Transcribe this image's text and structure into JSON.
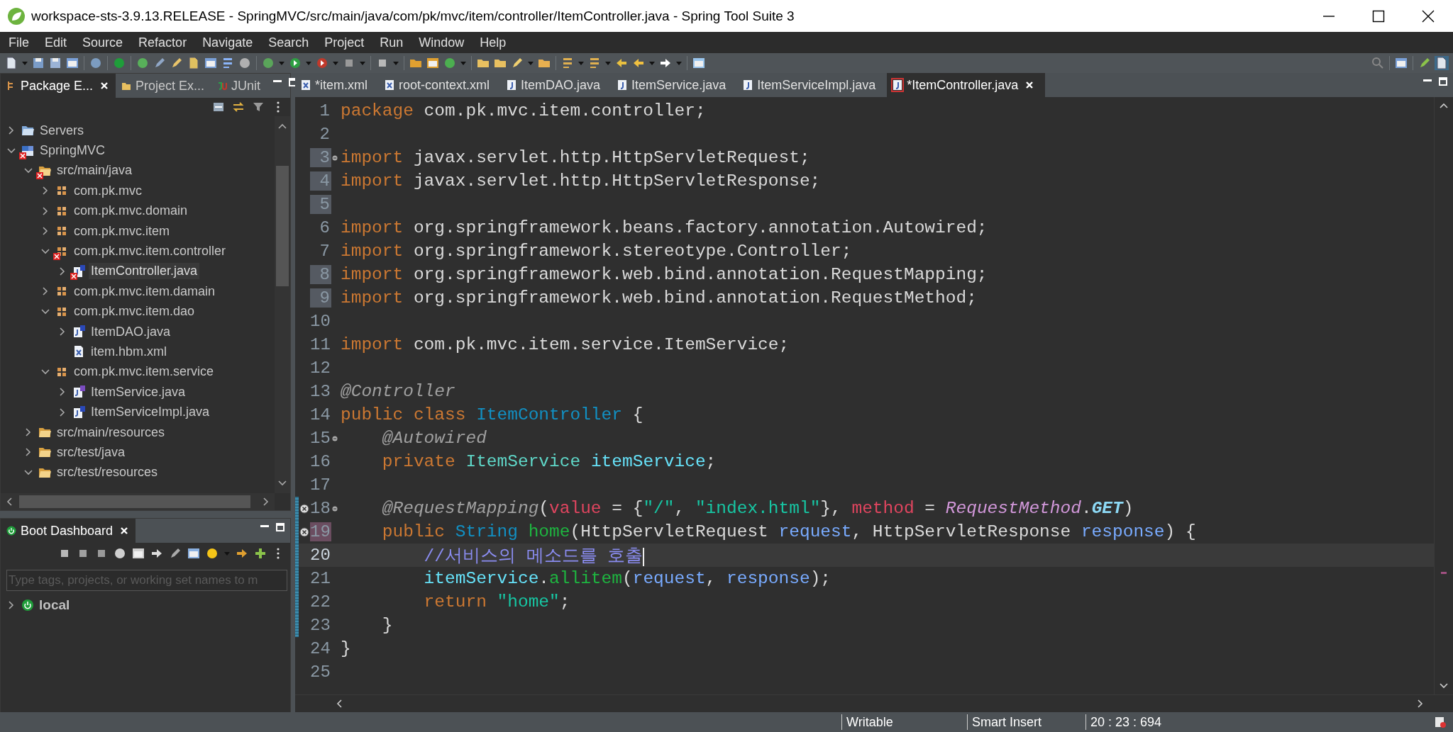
{
  "window": {
    "title": "workspace-sts-3.9.13.RELEASE - SpringMVC/src/main/java/com/pk/mvc/item/controller/ItemController.java - Spring Tool Suite 3"
  },
  "menu": [
    "File",
    "Edit",
    "Source",
    "Refactor",
    "Navigate",
    "Search",
    "Project",
    "Run",
    "Window",
    "Help"
  ],
  "explorer": {
    "tabs": [
      {
        "label": "Package E...",
        "selected": true,
        "kind": "package-explorer"
      },
      {
        "label": "Project Ex...",
        "selected": false,
        "kind": "project-explorer"
      },
      {
        "label": "JUnit",
        "selected": false,
        "kind": "junit"
      }
    ],
    "tree": [
      {
        "label": "Servers",
        "kind": "folder",
        "expanded": false,
        "selected": false,
        "error": false
      },
      {
        "label": "SpringMVC",
        "kind": "project",
        "expanded": true,
        "selected": false,
        "error": true,
        "children": [
          {
            "label": "src/main/java",
            "kind": "source-folder",
            "expanded": true,
            "selected": false,
            "error": true,
            "children": [
              {
                "label": "com.pk.mvc",
                "kind": "package",
                "expanded": false,
                "selected": false,
                "error": false
              },
              {
                "label": "com.pk.mvc.domain",
                "kind": "package",
                "expanded": false,
                "selected": false,
                "error": false
              },
              {
                "label": "com.pk.mvc.item",
                "kind": "package",
                "expanded": false,
                "selected": false,
                "error": false
              },
              {
                "label": "com.pk.mvc.item.controller",
                "kind": "package",
                "expanded": true,
                "selected": false,
                "error": true,
                "children": [
                  {
                    "label": "ItemController.java",
                    "kind": "java-class",
                    "expanded": false,
                    "selected": true,
                    "error": true
                  }
                ]
              },
              {
                "label": "com.pk.mvc.item.damain",
                "kind": "package",
                "expanded": false,
                "selected": false,
                "error": false
              },
              {
                "label": "com.pk.mvc.item.dao",
                "kind": "package",
                "expanded": true,
                "selected": false,
                "error": false,
                "children": [
                  {
                    "label": "ItemDAO.java",
                    "kind": "java-class",
                    "expanded": false,
                    "selected": false,
                    "error": false
                  },
                  {
                    "label": "item.hbm.xml",
                    "kind": "xml",
                    "selected": false,
                    "error": false
                  }
                ]
              },
              {
                "label": "com.pk.mvc.item.service",
                "kind": "package",
                "expanded": true,
                "selected": false,
                "error": false,
                "children": [
                  {
                    "label": "ItemService.java",
                    "kind": "java-interface",
                    "expanded": false,
                    "selected": false,
                    "error": false
                  },
                  {
                    "label": "ItemServiceImpl.java",
                    "kind": "java-class",
                    "expanded": false,
                    "selected": false,
                    "error": false
                  }
                ]
              }
            ]
          },
          {
            "label": "src/main/resources",
            "kind": "source-folder",
            "expanded": false,
            "selected": false,
            "error": false
          },
          {
            "label": "src/test/java",
            "kind": "source-folder",
            "expanded": false,
            "selected": false,
            "error": false
          },
          {
            "label": "src/test/resources",
            "kind": "source-folder",
            "expanded": true,
            "selected": false,
            "error": false
          }
        ]
      }
    ]
  },
  "boot_dashboard": {
    "tab": {
      "label": "Boot Dashboard",
      "selected": true
    },
    "filter": {
      "placeholder": "Type tags, projects, or working set names to m"
    },
    "items": [
      {
        "label": "local",
        "expanded": false
      }
    ]
  },
  "editor": {
    "tabs": [
      {
        "label": "*item.xml",
        "kind": "xml",
        "selected": false,
        "error": false
      },
      {
        "label": "root-context.xml",
        "kind": "xml",
        "selected": false,
        "error": false
      },
      {
        "label": "ItemDAO.java",
        "kind": "java",
        "selected": false,
        "error": false
      },
      {
        "label": "ItemService.java",
        "kind": "java",
        "selected": false,
        "error": false
      },
      {
        "label": "ItemServiceImpl.java",
        "kind": "java",
        "selected": false,
        "error": false
      },
      {
        "label": "*ItemController.java",
        "kind": "java",
        "selected": true,
        "error": true
      }
    ],
    "lines": [
      {
        "number": "1",
        "tokens": [
          {
            "text": "package",
            "kind": "keyword"
          },
          {
            "text": " com.pk.mvc.item.controller;",
            "kind": "plain"
          }
        ],
        "highlight": false,
        "fold": false,
        "error": false,
        "modified": false,
        "current": false
      },
      {
        "number": "2",
        "highlight": false,
        "fold": false,
        "error": false,
        "modified": false,
        "current": false
      },
      {
        "number": "3",
        "tokens": [
          {
            "text": "import",
            "kind": "keyword"
          },
          {
            "text": " javax.servlet.http.HttpServletRequest;",
            "kind": "plain"
          }
        ],
        "highlight": true,
        "fold": true,
        "error": false,
        "modified": false,
        "current": false
      },
      {
        "number": "4",
        "tokens": [
          {
            "text": "import",
            "kind": "keyword"
          },
          {
            "text": " javax.servlet.http.HttpServletResponse;",
            "kind": "plain"
          }
        ],
        "highlight": true,
        "fold": false,
        "error": false,
        "modified": false,
        "current": false
      },
      {
        "number": "5",
        "highlight": true,
        "fold": false,
        "error": false,
        "modified": false,
        "current": false
      },
      {
        "number": "6",
        "tokens": [
          {
            "text": "import",
            "kind": "keyword"
          },
          {
            "text": " org.springframework.beans.factory.annotation.Autowired;",
            "kind": "plain"
          }
        ],
        "highlight": false,
        "fold": false,
        "error": false,
        "modified": false,
        "current": false
      },
      {
        "number": "7",
        "tokens": [
          {
            "text": "import",
            "kind": "keyword"
          },
          {
            "text": " org.springframework.stereotype.Controller;",
            "kind": "plain"
          }
        ],
        "highlight": false,
        "fold": false,
        "error": false,
        "modified": false,
        "current": false
      },
      {
        "number": "8",
        "tokens": [
          {
            "text": "import",
            "kind": "keyword"
          },
          {
            "text": " org.springframework.web.bind.annotation.RequestMapping;",
            "kind": "plain"
          }
        ],
        "highlight": true,
        "fold": false,
        "error": false,
        "modified": false,
        "current": false
      },
      {
        "number": "9",
        "tokens": [
          {
            "text": "import",
            "kind": "keyword"
          },
          {
            "text": " org.springframework.web.bind.annotation.RequestMethod;",
            "kind": "plain"
          }
        ],
        "highlight": true,
        "fold": false,
        "error": false,
        "modified": false,
        "current": false
      },
      {
        "number": "10",
        "highlight": false,
        "fold": false,
        "error": false,
        "modified": false,
        "current": false
      },
      {
        "number": "11",
        "tokens": [
          {
            "text": "import",
            "kind": "keyword"
          },
          {
            "text": " com.pk.mvc.item.service.ItemService;",
            "kind": "plain"
          }
        ],
        "highlight": false,
        "fold": false,
        "error": false,
        "modified": false,
        "current": false
      },
      {
        "number": "12",
        "highlight": false,
        "fold": false,
        "error": false,
        "modified": false,
        "current": false
      },
      {
        "number": "13",
        "tokens": [
          {
            "text": "@Controller",
            "kind": "annotation"
          }
        ],
        "highlight": false,
        "fold": false,
        "error": false,
        "modified": false,
        "current": false
      },
      {
        "number": "14",
        "tokens": [
          {
            "text": "public class ",
            "kind": "keyword"
          },
          {
            "text": "ItemController",
            "kind": "class"
          },
          {
            "text": " {",
            "kind": "plain"
          }
        ],
        "highlight": false,
        "fold": false,
        "error": false,
        "modified": false,
        "current": false
      },
      {
        "number": "15",
        "tokens": [
          {
            "text": "    @Autowired",
            "kind": "annotation"
          }
        ],
        "highlight": false,
        "fold": true,
        "error": false,
        "modified": false,
        "current": false
      },
      {
        "number": "16",
        "tokens": [
          {
            "text": "    private ",
            "kind": "keyword"
          },
          {
            "text": "ItemService ",
            "kind": "type"
          },
          {
            "text": "itemService",
            "kind": "field"
          },
          {
            "text": ";",
            "kind": "plain"
          }
        ],
        "highlight": false,
        "fold": false,
        "error": false,
        "modified": false,
        "current": false
      },
      {
        "number": "17",
        "highlight": false,
        "fold": false,
        "error": false,
        "modified": false,
        "current": false
      },
      {
        "number": "18",
        "tokens": [
          {
            "text": "    @RequestMapping",
            "kind": "annotation"
          },
          {
            "text": "(",
            "kind": "plain"
          },
          {
            "text": "value",
            "kind": "attribute"
          },
          {
            "text": " = {",
            "kind": "plain"
          },
          {
            "text": "\"/\"",
            "kind": "string"
          },
          {
            "text": ", ",
            "kind": "plain"
          },
          {
            "text": "\"index.html\"",
            "kind": "string"
          },
          {
            "text": "}, ",
            "kind": "plain"
          },
          {
            "text": "method",
            "kind": "attribute"
          },
          {
            "text": " = ",
            "kind": "plain"
          },
          {
            "text": "RequestMethod",
            "kind": "enum"
          },
          {
            "text": ".",
            "kind": "plain"
          },
          {
            "text": "GET",
            "kind": "constant"
          },
          {
            "text": ")",
            "kind": "plain"
          }
        ],
        "highlight": false,
        "fold": true,
        "error": true,
        "modified": true,
        "current": false
      },
      {
        "number": "19",
        "tokens": [
          {
            "text": "    public ",
            "kind": "keyword"
          },
          {
            "text": "String ",
            "kind": "class"
          },
          {
            "text": "home",
            "kind": "method"
          },
          {
            "text": "(HttpServletRequest ",
            "kind": "plain"
          },
          {
            "text": "request",
            "kind": "parameter"
          },
          {
            "text": ", HttpServletResponse ",
            "kind": "plain"
          },
          {
            "text": "response",
            "kind": "parameter"
          },
          {
            "text": ") {",
            "kind": "plain"
          }
        ],
        "highlight": true,
        "fold": false,
        "error": true,
        "modified": true,
        "current": false
      },
      {
        "number": "20",
        "tokens": [
          {
            "text": "        //서비스의 메소드를 호출",
            "kind": "comment"
          }
        ],
        "highlight": false,
        "fold": false,
        "error": false,
        "modified": true,
        "current": true
      },
      {
        "number": "21",
        "tokens": [
          {
            "text": "        itemService",
            "kind": "field"
          },
          {
            "text": ".",
            "kind": "plain"
          },
          {
            "text": "allitem",
            "kind": "method"
          },
          {
            "text": "(",
            "kind": "plain"
          },
          {
            "text": "request",
            "kind": "parameter"
          },
          {
            "text": ", ",
            "kind": "plain"
          },
          {
            "text": "response",
            "kind": "parameter"
          },
          {
            "text": ");",
            "kind": "plain"
          }
        ],
        "highlight": false,
        "fold": false,
        "error": false,
        "modified": true,
        "current": false
      },
      {
        "number": "22",
        "tokens": [
          {
            "text": "        return ",
            "kind": "keyword"
          },
          {
            "text": "\"home\"",
            "kind": "string"
          },
          {
            "text": ";",
            "kind": "plain"
          }
        ],
        "highlight": false,
        "fold": false,
        "error": false,
        "modified": true,
        "current": false
      },
      {
        "number": "23",
        "tokens": [
          {
            "text": "    }",
            "kind": "plain"
          }
        ],
        "highlight": false,
        "fold": false,
        "error": false,
        "modified": true,
        "current": false
      },
      {
        "number": "24",
        "tokens": [
          {
            "text": "}",
            "kind": "plain"
          }
        ],
        "highlight": false,
        "fold": false,
        "error": false,
        "modified": false,
        "current": false
      },
      {
        "number": "25",
        "highlight": false,
        "fold": false,
        "error": false,
        "modified": false,
        "current": false
      }
    ]
  },
  "status_bar": {
    "mode": "Writable",
    "insert": "Smart Insert",
    "position": "20 : 23 : 694"
  }
}
